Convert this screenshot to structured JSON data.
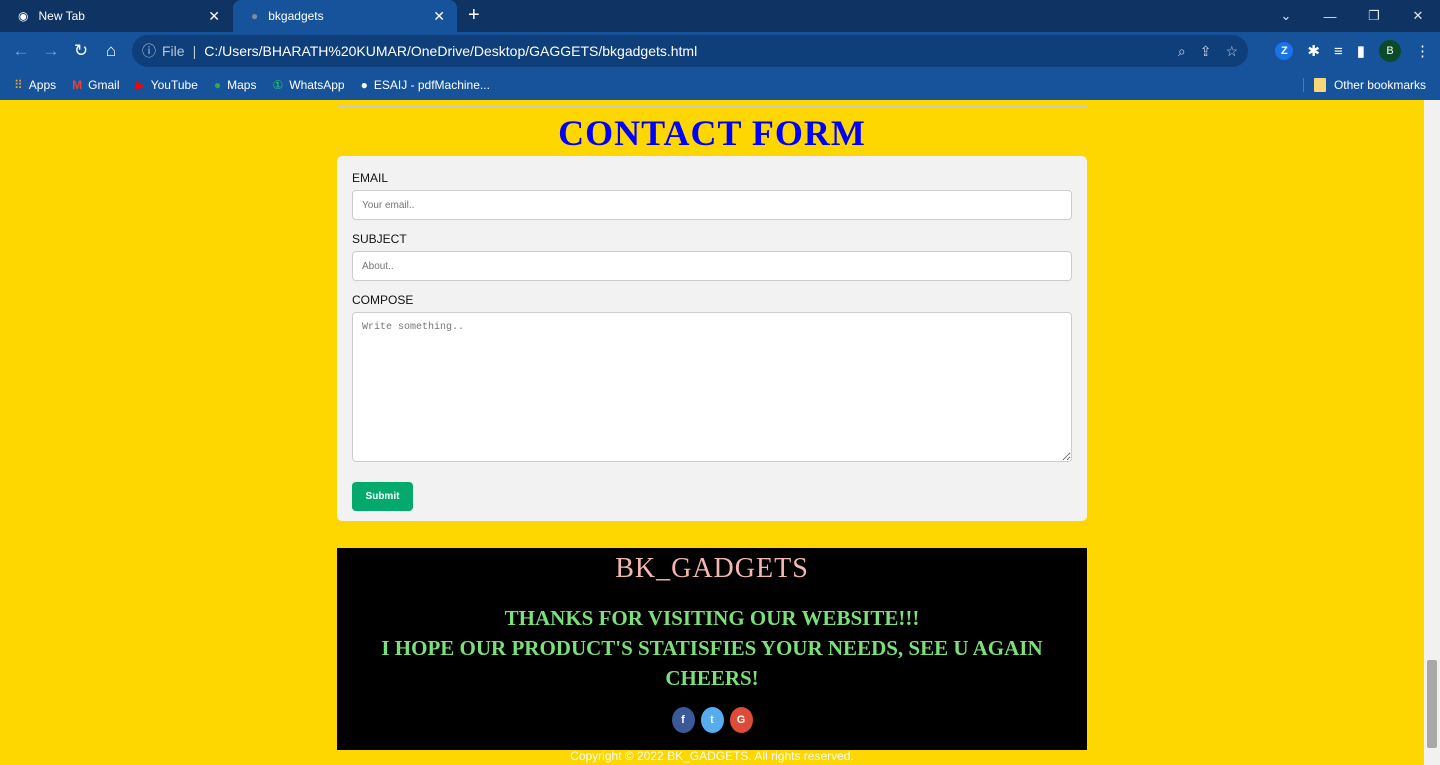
{
  "browser": {
    "tabs": [
      {
        "label": "New Tab"
      },
      {
        "label": "bkgadgets"
      }
    ],
    "address": {
      "scheme_label": "File",
      "url": "C:/Users/BHARATH%20KUMAR/OneDrive/Desktop/GAGGETS/bkgadgets.html"
    },
    "profile_initial": "B",
    "extension_letter": "Z",
    "bookmarks": [
      {
        "label": "Apps",
        "icon": "apps-grid-icon"
      },
      {
        "label": "Gmail",
        "icon": "gmail-icon"
      },
      {
        "label": "YouTube",
        "icon": "youtube-icon"
      },
      {
        "label": "Maps",
        "icon": "maps-pin-icon"
      },
      {
        "label": "WhatsApp",
        "icon": "whatsapp-icon"
      },
      {
        "label": "ESAIJ - pdfMachine...",
        "icon": "globe-icon"
      }
    ],
    "other_bookmarks": "Other bookmarks"
  },
  "page": {
    "title": "CONTACT FORM",
    "form": {
      "email_label": "EMAIL",
      "email_placeholder": "Your email..",
      "subject_label": "SUBJECT",
      "subject_placeholder": "About..",
      "compose_label": "COMPOSE",
      "compose_placeholder": "Write something..",
      "submit_label": "Submit"
    },
    "footer": {
      "brand": "BK_GADGETS",
      "thanks_line1": "THANKS FOR VISITING OUR WEBSITE!!!",
      "thanks_line2": "I HOPE OUR PRODUCT'S STATISFIES YOUR NEEDS, SEE U AGAIN CHEERS!",
      "social": [
        {
          "glyph": "f",
          "icon": "facebook-icon",
          "color": "#3b5998"
        },
        {
          "glyph": "t",
          "icon": "twitter-icon",
          "color": "#55acee"
        },
        {
          "glyph": "G",
          "icon": "google-icon",
          "color": "#dd4b39"
        }
      ],
      "copyright": "Copyright © 2022 BK_GADGETS. All rights reserved."
    }
  }
}
